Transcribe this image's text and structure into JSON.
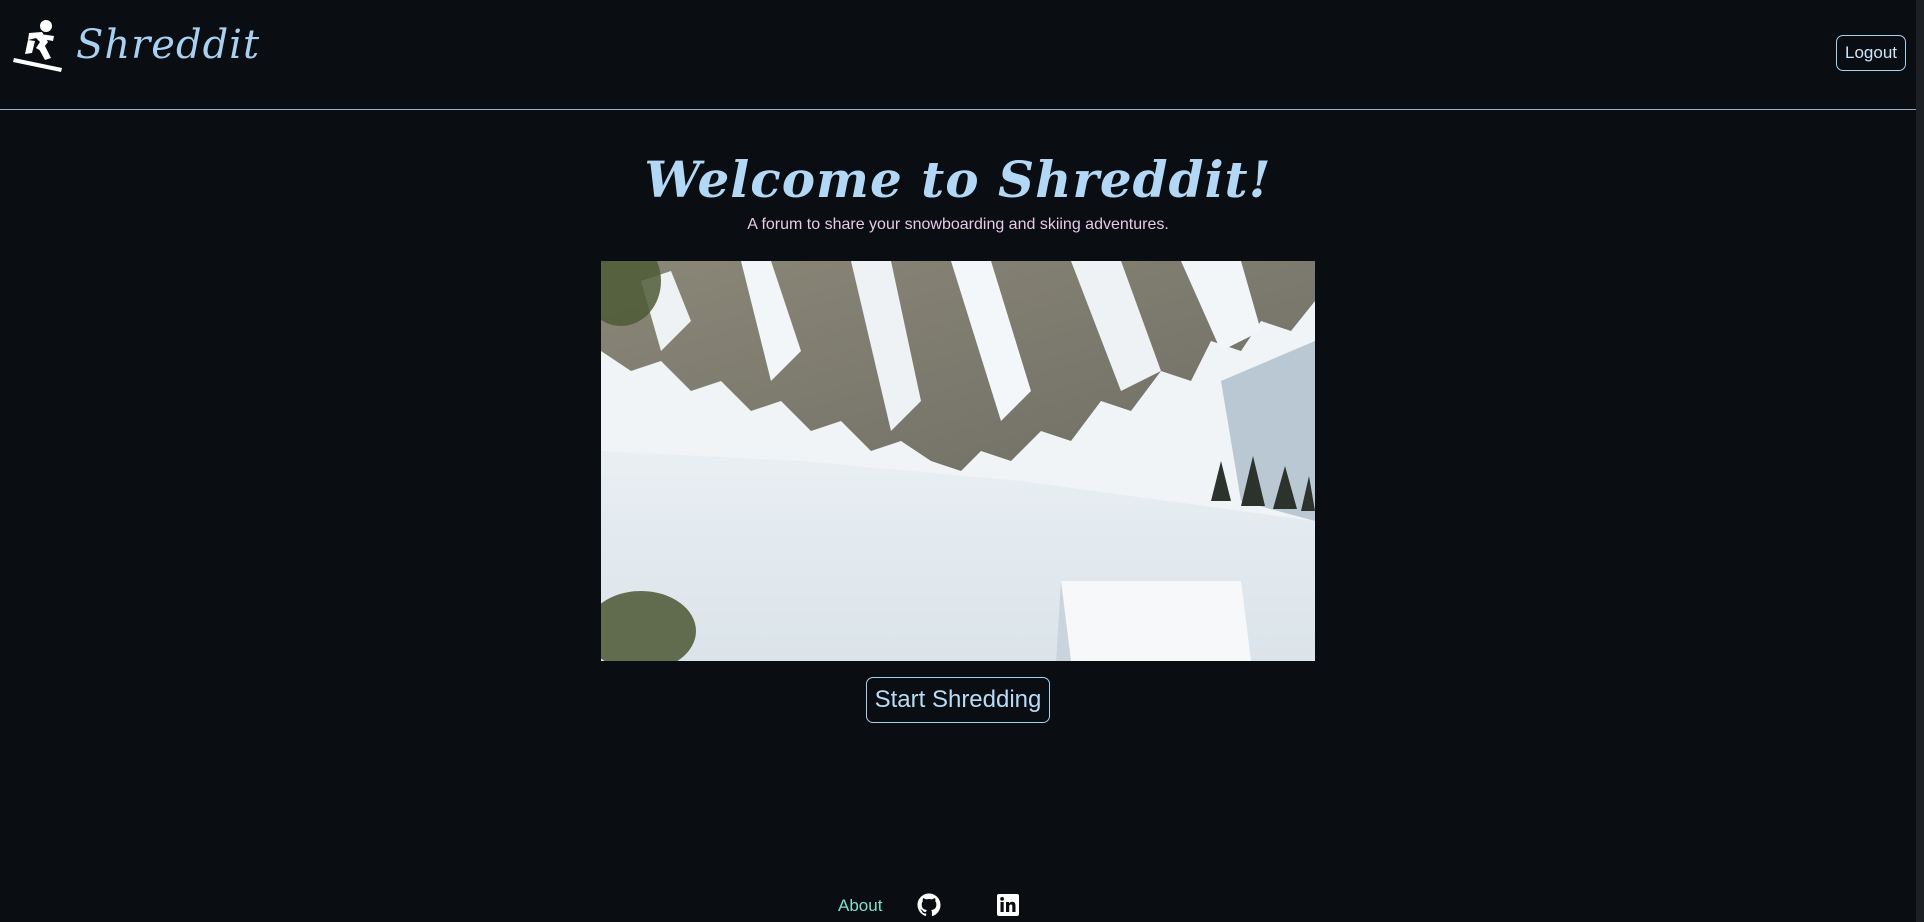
{
  "header": {
    "brand_name": "Shreddit",
    "logout_label": "Logout"
  },
  "hero": {
    "title": "Welcome to Shreddit!",
    "subtitle": "A forum to share your snowboarding and skiing adventures.",
    "cta_label": "Start Shredding"
  },
  "footer": {
    "about_label": "About"
  },
  "icons": {
    "brand": "snowboarder-icon",
    "github": "github-icon",
    "linkedin": "linkedin-icon"
  },
  "colors": {
    "background": "#0a0d12",
    "accent": "#a8d0f0",
    "subtitle": "#e7c9e8",
    "footer_link": "#7fe0c8"
  }
}
